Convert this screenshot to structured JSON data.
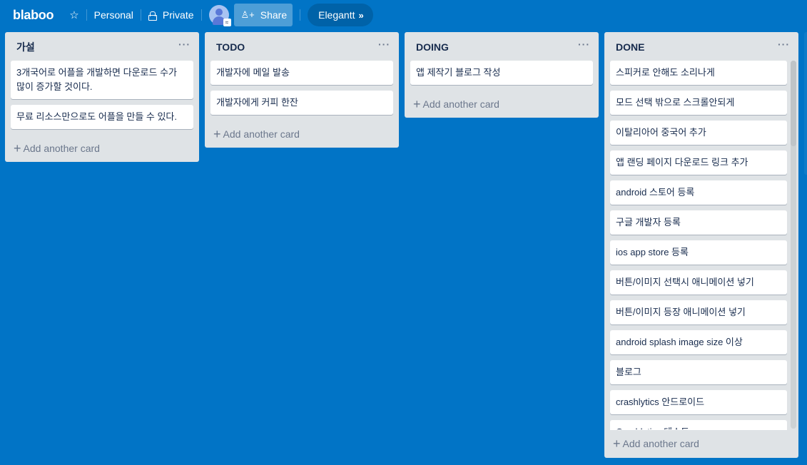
{
  "header": {
    "board_name": "blaboo",
    "star_icon": "☆",
    "team_label": "Personal",
    "visibility_label": "Private",
    "share_label": "Share",
    "share_icon": "♙+",
    "powerup_label": "Elegantt",
    "powerup_icon": "»",
    "avatar_badge": "≈"
  },
  "lists": [
    {
      "title": "가설",
      "menu_icon": "···",
      "cards": [
        "3개국어로 어플을 개발하면 다운로드 수가 많이 증가할 것이다.",
        "무료 리소스만으로도 어플을 만들 수 있다."
      ],
      "add_card_label": "Add another card"
    },
    {
      "title": "TODO",
      "menu_icon": "···",
      "cards": [
        "개발자에 메일 발송",
        "개발자에게 커피 한잔"
      ],
      "add_card_label": "Add another card"
    },
    {
      "title": "DOING",
      "menu_icon": "···",
      "cards": [
        "앱 제작기 블로그 작성"
      ],
      "add_card_label": "Add another card"
    },
    {
      "title": "DONE",
      "menu_icon": "···",
      "cards": [
        "스피커로 안해도 소리나게",
        "모드 선택 밖으로 스크롤안되게",
        "이탈리아어 중국어 추가",
        "앱 랜딩 페이지 다운로드 링크 추가",
        "android 스토어 등록",
        "구글 개발자 등록",
        "ios app store 등록",
        "버튼/이미지 선택시 애니메이션 넣기",
        "버튼/이미지 등장 애니메이션 넣기",
        "android splash image size 이상",
        "블로그",
        "crashlytics 안드로이드",
        "Crashlytics 테스트"
      ],
      "add_card_label": "Add another card"
    }
  ],
  "add_icon": "+",
  "colors": {
    "board_background": "#0174c6",
    "list_background": "#dfe3e6",
    "card_background": "#ffffff",
    "text": "#172b4d",
    "muted_text": "#6b778c"
  }
}
